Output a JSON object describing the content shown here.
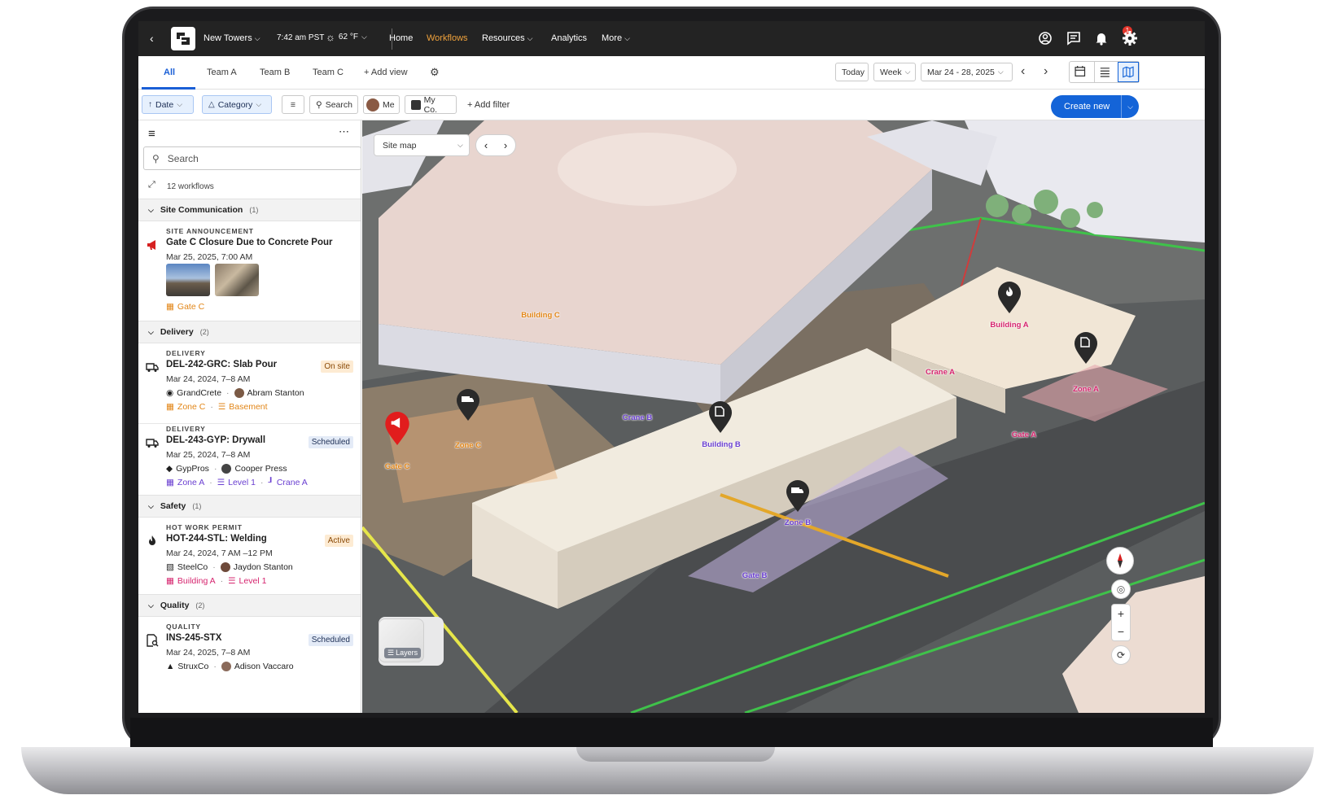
{
  "topnav": {
    "project": "New Towers",
    "time": "7:42 am PST",
    "weather": "62 °F",
    "items": [
      "Home",
      "Workflows",
      "Resources",
      "Analytics",
      "More"
    ],
    "active": "Workflows",
    "notifications": "1"
  },
  "tabs": {
    "items": [
      "All",
      "Team A",
      "Team B",
      "Team C"
    ],
    "add_view": "Add view",
    "today": "Today",
    "range_unit": "Week",
    "date_range": "Mar 24 - 28, 2025"
  },
  "filters": {
    "date": "Date",
    "category": "Category",
    "search": "Search",
    "me": "Me",
    "company": "My Co.",
    "add_filter": "Add filter",
    "create": "Create new"
  },
  "sidebar": {
    "search_placeholder": "Search",
    "count": "12 workflows",
    "sections": [
      {
        "name": "Site Communication",
        "count": "(1)"
      },
      {
        "name": "Delivery",
        "count": "(2)"
      },
      {
        "name": "Safety",
        "count": "(1)"
      },
      {
        "name": "Quality",
        "count": "(2)"
      }
    ],
    "cards": [
      {
        "kind": "SITE ANNOUNCEMENT",
        "title": "Gate C Closure Due to Concrete Pour",
        "date": "Mar 25, 2025, 7:00 AM",
        "location": "Gate C"
      },
      {
        "kind": "DELIVERY",
        "title": "DEL-242-GRC: Slab Pour",
        "status": "On site",
        "date": "Mar 24, 2024, 7–8 AM",
        "company": "GrandCrete",
        "person": "Abram Stanton",
        "loc1": "Zone C",
        "loc2": "Basement"
      },
      {
        "kind": "DELIVERY",
        "title": "DEL-243-GYP: Drywall",
        "status": "Scheduled",
        "date": "Mar 25, 2024, 7–8 AM",
        "company": "GypPros",
        "person": "Cooper Press",
        "loc1": "Zone A",
        "loc2": "Level 1",
        "loc3": "Crane A"
      },
      {
        "kind": "HOT WORK PERMIT",
        "title": "HOT-244-STL: Welding",
        "status": "Active",
        "date": "Mar 24, 2024, 7 AM –12 PM",
        "company": "SteelCo",
        "person": "Jaydon Stanton",
        "loc1": "Building A",
        "loc2": "Level 1"
      },
      {
        "kind": "QUALITY",
        "title": "INS-245-STX",
        "status": "Scheduled",
        "date": "Mar 24, 2025, 7–8 AM",
        "company": "StruxCo",
        "person": "Adison Vaccaro"
      }
    ]
  },
  "map": {
    "view": "Site map",
    "layers": "Layers",
    "labels": [
      "Building C",
      "Building A",
      "Crane A",
      "Zone A",
      "Crane B",
      "Building B",
      "Gate A",
      "Zone C",
      "Gate C",
      "Zone B",
      "Gate B"
    ]
  },
  "colors": {
    "accent": "#1464d8",
    "active_nav": "#f0a23c",
    "orange": "#e28618",
    "purple": "#6a3fd1",
    "pink": "#d6246e"
  }
}
